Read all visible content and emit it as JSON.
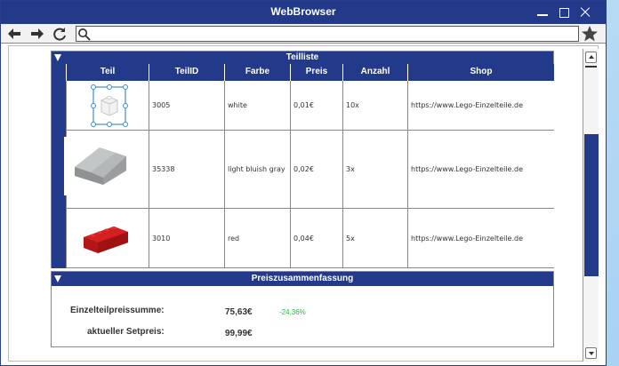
{
  "window": {
    "title": "WebBrowser"
  },
  "toolbar": {
    "address_value": ""
  },
  "parts_panel": {
    "title": "Teilliste",
    "columns": [
      "Teil",
      "TeilID",
      "Farbe",
      "Preis",
      "Anzahl",
      "Shop"
    ],
    "rows": [
      {
        "image_icon": "white-brick-image",
        "id": "3005",
        "color": "white",
        "price": "0,01€",
        "count": "10x",
        "shop": "https://www.Lego-Einzelteile.de"
      },
      {
        "image_icon": "light-bluish-gray-slope-image",
        "id": "35338",
        "color": "light bluish gray",
        "price": "0,02€",
        "count": "3x",
        "shop": "https://www.Lego-Einzelteile.de"
      },
      {
        "image_icon": "red-brick-image",
        "id": "3010",
        "color": "red",
        "price": "0,04€",
        "count": "5x",
        "shop": "https://www.Lego-Einzelteile.de"
      }
    ]
  },
  "summary_panel": {
    "title": "Preiszusammenfassung",
    "sum_label": "Einzelteilpreissumme:",
    "sum_value": "75,63€",
    "sum_percent": "-24,36%",
    "set_label": "aktueller Setpreis:",
    "set_value": "99,99€"
  },
  "colors": {
    "accent": "#233a8a",
    "percent_green": "#22c03a",
    "brick_white": "#f2f2f2",
    "brick_gray": "#a9adae",
    "brick_red": "#c41a1a",
    "selection": "#3b8bd9"
  }
}
